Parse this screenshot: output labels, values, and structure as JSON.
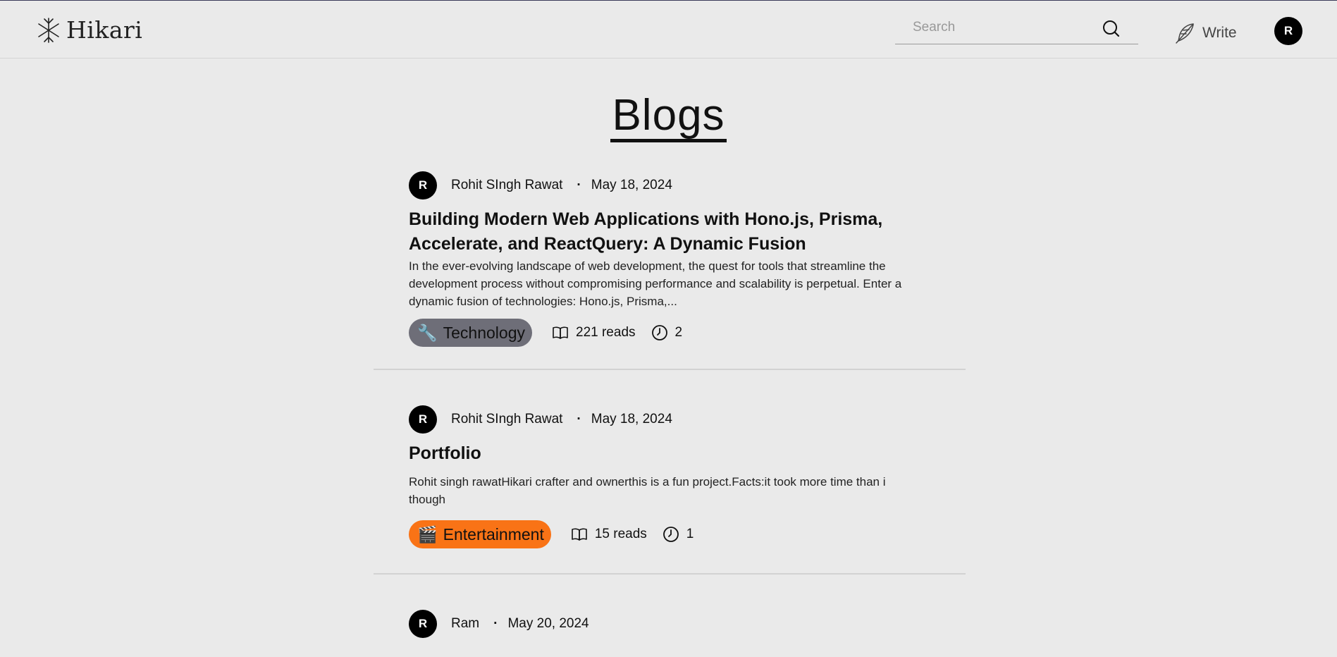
{
  "header": {
    "logo_text": "Hikari",
    "search_placeholder": "Search",
    "write_label": "Write",
    "user_initial": "R"
  },
  "page_title": "Blogs",
  "posts": [
    {
      "avatar": "R",
      "author": "Rohit SIngh Rawat",
      "separator": "·",
      "date": "May 18, 2024",
      "title": "Building Modern Web Applications with Hono.js, Prisma, Accelerate, and ReactQuery: A Dynamic Fusion",
      "excerpt": "In the ever-evolving landscape of web development, the quest for tools that streamline the development process without compromising performance and scalability is perpetual. Enter a dynamic fusion of technologies: Hono.js, Prisma,...",
      "tag_emoji": "🔧",
      "tag": "Technology",
      "tag_color": "#6e6e78",
      "reads": "221 reads",
      "read_time": "2"
    },
    {
      "avatar": "R",
      "author": "Rohit SIngh Rawat",
      "separator": "·",
      "date": "May 18, 2024",
      "title": "Portfolio",
      "excerpt": "Rohit singh rawatHikari crafter and ownerthis is a fun project.Facts:it took more time than i though",
      "tag_emoji": "🎬",
      "tag": "Entertainment",
      "tag_color": "#f97316",
      "reads": "15 reads",
      "read_time": "1"
    },
    {
      "avatar": "R",
      "author": "Ram",
      "separator": "·",
      "date": "May 20, 2024"
    }
  ],
  "icons": {
    "logo": "asterisk-logo-icon",
    "search": "search-icon",
    "write": "feather-icon",
    "reads": "open-book-icon",
    "time": "clock-icon"
  }
}
